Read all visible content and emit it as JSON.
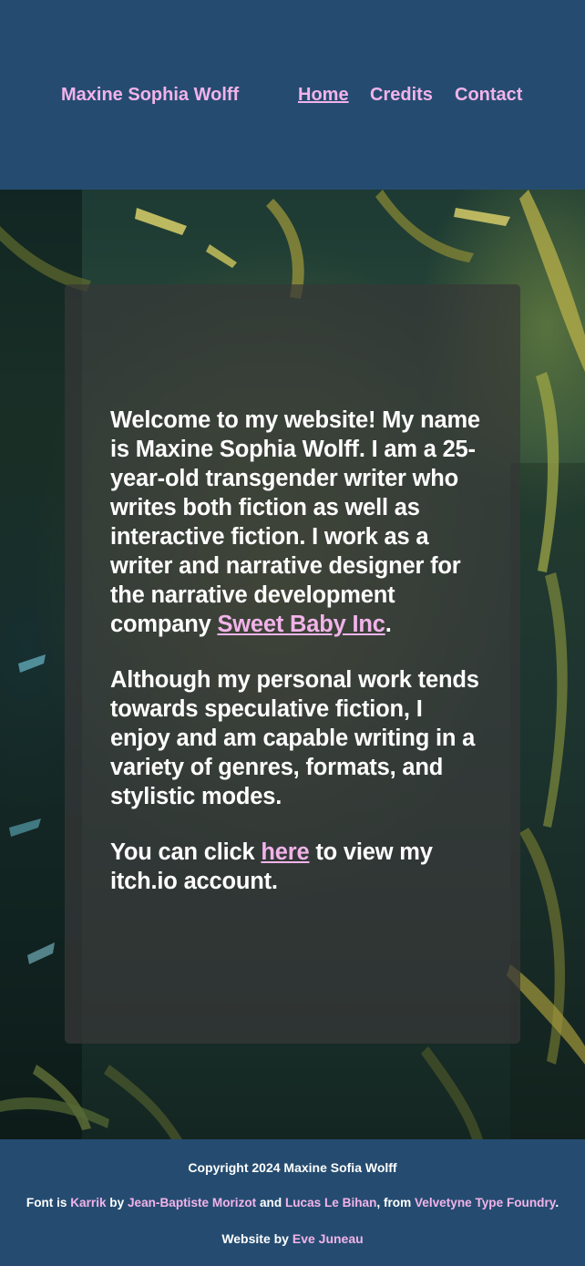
{
  "header": {
    "site_name": "Maxine Sophia Wolff",
    "nav": [
      {
        "label": "Home",
        "active": true
      },
      {
        "label": "Credits",
        "active": false
      },
      {
        "label": "Contact",
        "active": false
      }
    ]
  },
  "main": {
    "intro_text": "Welcome to my website! My name is Maxine Sophia Wolff. I am a 25-year-old transgender writer who writes both fiction as well as interactive fiction. I work as a writer and narrative designer for the narrative development company ",
    "company_link": "Sweet Baby Inc",
    "intro_end": ".",
    "paragraph2": "Although my personal work tends towards speculative fiction, I enjoy and am capable writing in a variety of genres, formats, and stylistic modes.",
    "p3_before": "You can click ",
    "p3_link": "here",
    "p3_after": " to view my itch.io account."
  },
  "footer": {
    "copyright": "Copyright 2024 Maxine Sofia Wolff",
    "font_prefix": "Font is ",
    "font_name": "Karrik",
    "by": " by ",
    "designer1": "Jean-Baptiste Morizot",
    "and": " and ",
    "designer2": "Lucas Le Bihan",
    "from": ", from ",
    "foundry": "Velvetyne Type Foundry",
    "period": ".",
    "website_prefix": "Website by ",
    "website_author": "Eve Juneau"
  },
  "colors": {
    "header_bg": "#254c70",
    "link_pink": "#f2b3ea",
    "card_bg": "#373737"
  }
}
